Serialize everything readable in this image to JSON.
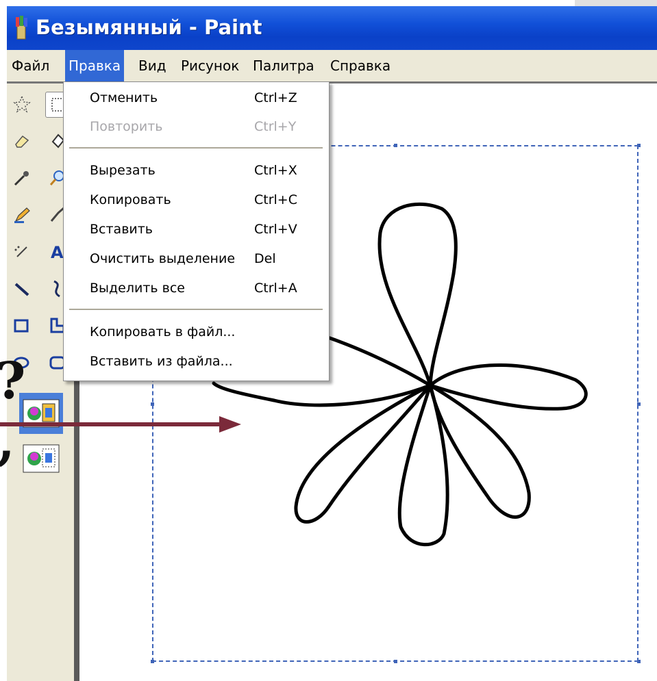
{
  "window": {
    "title": "Безымянный - Paint",
    "title_color": "#1150d8"
  },
  "menubar": {
    "items": [
      "Файл",
      "Правка",
      "Вид",
      "Рисунок",
      "Палитра",
      "Справка"
    ],
    "active": "Правка",
    "active_color": "#3168d5"
  },
  "edit_menu": {
    "items": [
      {
        "label": "Отменить",
        "shortcut": "Ctrl+Z",
        "enabled": true
      },
      {
        "label": "Повторить",
        "shortcut": "Ctrl+Y",
        "enabled": false
      },
      {
        "label": "Вырезать",
        "shortcut": "Ctrl+X",
        "enabled": true
      },
      {
        "label": "Копировать",
        "shortcut": "Ctrl+C",
        "enabled": true
      },
      {
        "label": "Вставить",
        "shortcut": "Ctrl+V",
        "enabled": true
      },
      {
        "label": "Очистить выделение",
        "shortcut": "Del",
        "enabled": true
      },
      {
        "label": "Выделить все",
        "shortcut": "Ctrl+A",
        "enabled": true
      },
      {
        "label": "Копировать в файл...",
        "shortcut": "",
        "enabled": true
      },
      {
        "label": "Вставить из файла...",
        "shortcut": "",
        "enabled": true
      }
    ]
  },
  "toolbox": {
    "tools": [
      "free-select-icon",
      "rect-select-icon",
      "eraser-icon",
      "fill-icon",
      "picker-icon",
      "magnifier-icon",
      "pencil-icon",
      "brush-icon",
      "airbrush-icon",
      "text-icon",
      "line-icon",
      "curve-icon",
      "rectangle-icon",
      "polygon-icon",
      "ellipse-icon",
      "rounded-rect-icon"
    ],
    "options": [
      "opaque-paste-icon",
      "transparent-paste-icon"
    ],
    "selected_option": "opaque-paste-icon"
  },
  "slide_overlay": {
    "glyphs": [
      "?",
      ","
    ],
    "arrow_color": "#7b2a3a"
  }
}
